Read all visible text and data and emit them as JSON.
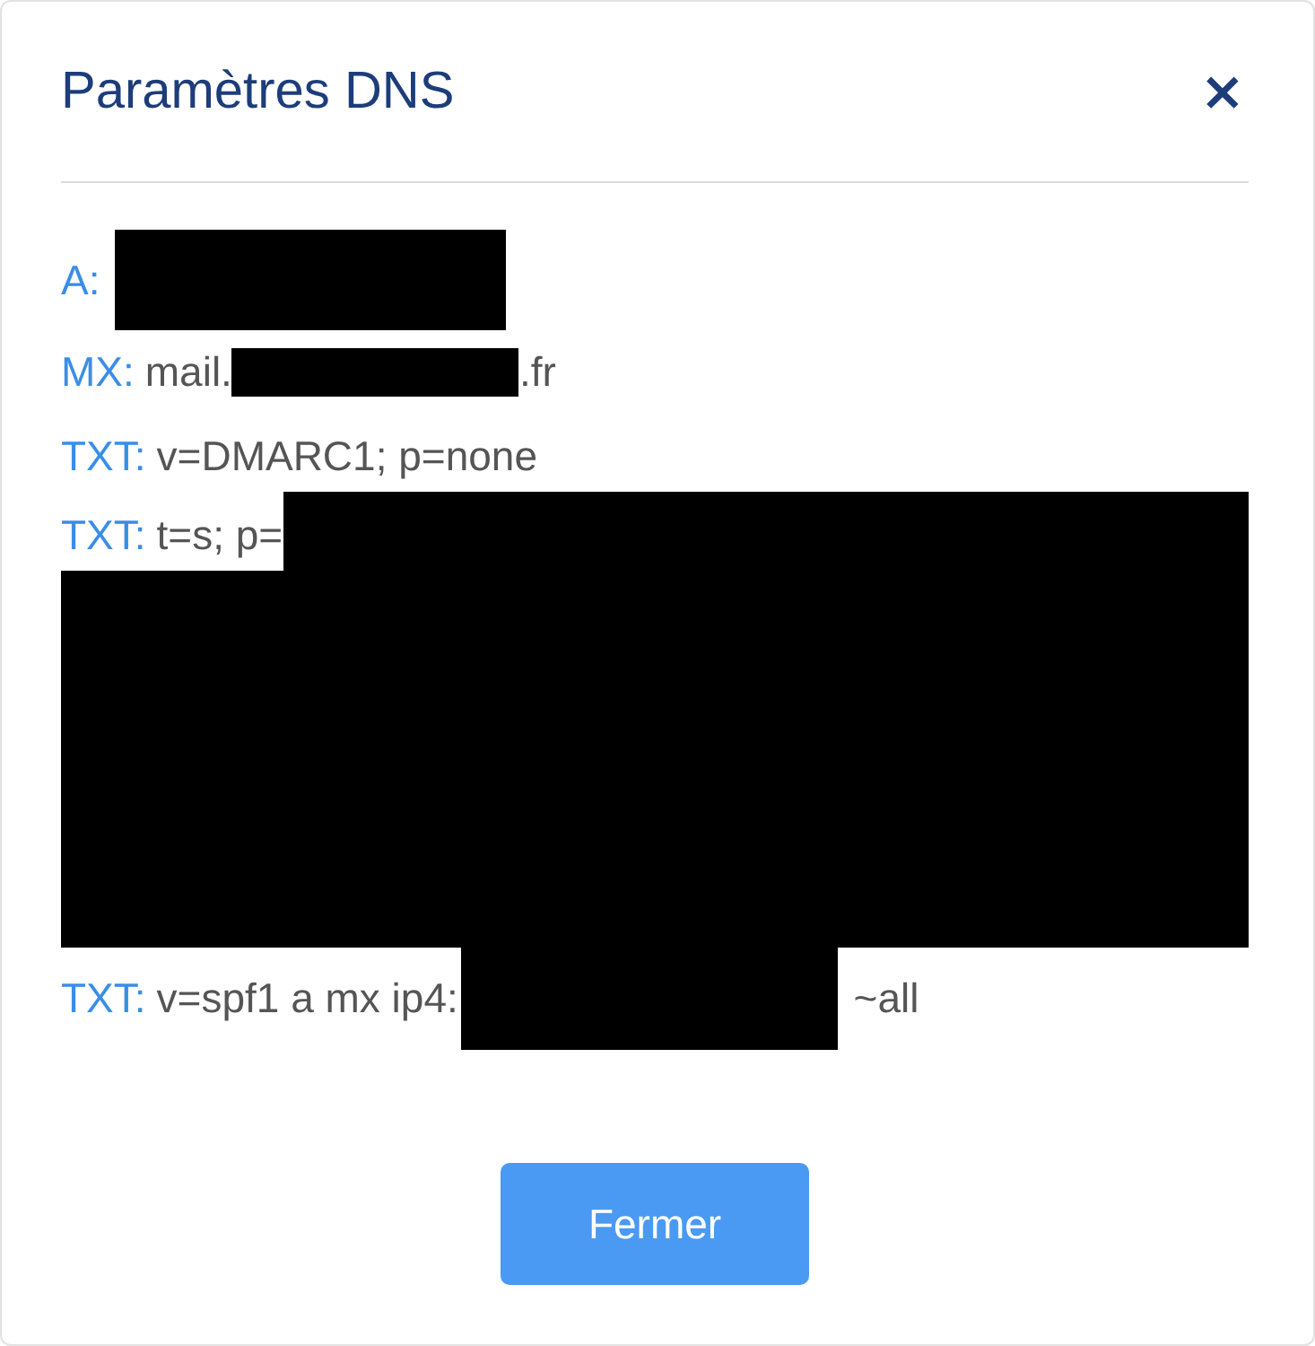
{
  "dialog": {
    "title": "Paramètres DNS",
    "close": "×"
  },
  "records": [
    {
      "label": "A:",
      "parts": [
        {
          "kind": "tallblock"
        }
      ]
    },
    {
      "label": "MX:",
      "parts": [
        {
          "kind": "text",
          "text": "mail."
        },
        {
          "kind": "shortblock"
        },
        {
          "kind": "text",
          "text": ".fr"
        }
      ]
    },
    {
      "label": "TXT:",
      "parts": [
        {
          "kind": "text",
          "text": "v=DMARC1; p=none"
        }
      ]
    },
    {
      "label": "TXT:",
      "parts": [
        {
          "kind": "text",
          "text": "t=s; p="
        },
        {
          "kind": "restblock"
        },
        {
          "kind": "paragraphblock"
        }
      ]
    },
    {
      "label": "TXT:",
      "parts": [
        {
          "kind": "text",
          "text": "v=spf1 a mx ip4:"
        },
        {
          "kind": "mediumblock"
        },
        {
          "kind": "text",
          "text": " ~all"
        }
      ]
    }
  ],
  "buttons": [
    {
      "label": "Fermer"
    }
  ]
}
